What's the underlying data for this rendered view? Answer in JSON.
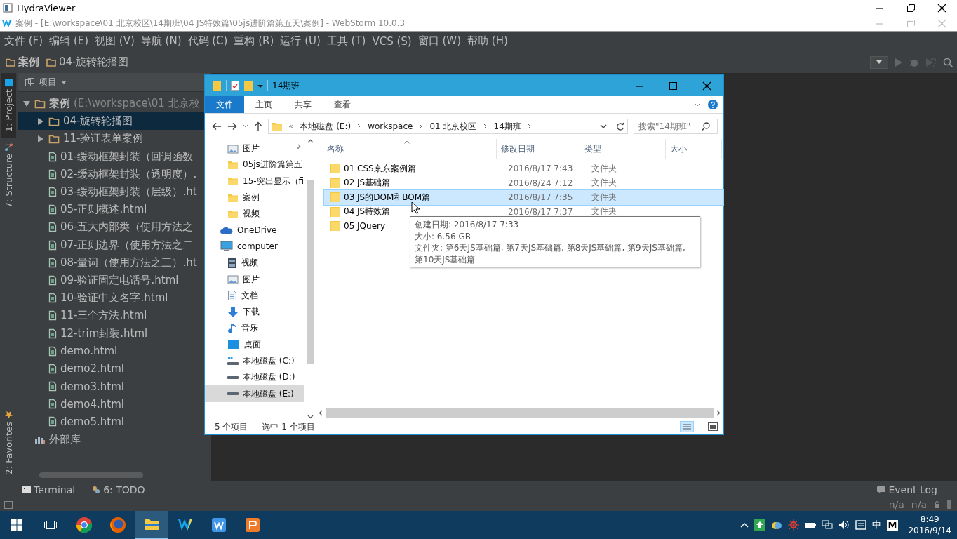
{
  "viewer": {
    "title": "HydraViewer"
  },
  "ide": {
    "title": "案例 - [E:\\workspace\\01 北京校区\\14期班\\04 JS特效篇\\05js进阶篇第五天\\案例] - WebStorm 10.0.3",
    "menu": [
      "文件 (F)",
      "编辑 (E)",
      "视图 (V)",
      "导航 (N)",
      "代码 (C)",
      "重构 (R)",
      "运行 (U)",
      "工具 (T)",
      "VCS (S)",
      "窗口 (W)",
      "帮助 (H)"
    ],
    "breadcrumbs": [
      "案例",
      "04-旋转轮播图"
    ],
    "side_tabs": [
      {
        "label": "1: Project",
        "selected": true
      },
      {
        "label": "7: Structure",
        "selected": false
      }
    ],
    "favorites_tab": "2: Favorites",
    "project_panel": {
      "title": "项目",
      "tree": [
        {
          "label": "案例",
          "detail": "(E:\\workspace\\01 北京校",
          "kind": "folder",
          "expanded": true,
          "selected": false,
          "children": [
            {
              "label": "04-旋转轮播图",
              "kind": "folder",
              "expanded": false,
              "selected": true
            },
            {
              "label": "11-验证表单案例",
              "kind": "folder",
              "expanded": false,
              "selected": false
            },
            {
              "label": "01-缓动框架封装（回调函数",
              "kind": "file",
              "selected": false
            },
            {
              "label": "02-缓动框架封装（透明度）.",
              "kind": "file",
              "selected": false
            },
            {
              "label": "03-缓动框架封装（层级）.ht",
              "kind": "file",
              "selected": false
            },
            {
              "label": "05-正则概述.html",
              "kind": "file",
              "selected": false
            },
            {
              "label": "06-五大内部类（使用方法之",
              "kind": "file",
              "selected": false
            },
            {
              "label": "07-正则边界（使用方法之二",
              "kind": "file",
              "selected": false
            },
            {
              "label": "08-量词（使用方法之三）.ht",
              "kind": "file",
              "selected": false
            },
            {
              "label": "09-验证固定电话号.html",
              "kind": "file",
              "selected": false
            },
            {
              "label": "10-验证中文名字.html",
              "kind": "file",
              "selected": false
            },
            {
              "label": "11-三个方法.html",
              "kind": "file",
              "selected": false
            },
            {
              "label": "12-trim封装.html",
              "kind": "file",
              "selected": false
            },
            {
              "label": "demo.html",
              "kind": "file",
              "selected": false
            },
            {
              "label": "demo2.html",
              "kind": "file",
              "selected": false
            },
            {
              "label": "demo3.html",
              "kind": "file",
              "selected": false
            },
            {
              "label": "demo4.html",
              "kind": "file",
              "selected": false
            },
            {
              "label": "demo5.html",
              "kind": "file",
              "selected": false
            }
          ]
        },
        {
          "label": "外部库",
          "kind": "library",
          "selected": false
        }
      ]
    },
    "bottom_tabs": [
      "Terminal",
      "6: TODO"
    ],
    "event_log": "Event Log",
    "status": [
      "n/a",
      "n/a"
    ]
  },
  "explorer": {
    "title": "14期班",
    "ribbon_tabs": [
      {
        "label": "文件",
        "selected": true
      },
      {
        "label": "主页",
        "selected": false
      },
      {
        "label": "共享",
        "selected": false
      },
      {
        "label": "查看",
        "selected": false
      }
    ],
    "overflow_mark": "«",
    "path": [
      "本地磁盘 (E:)",
      "workspace",
      "01 北京校区",
      "14期班"
    ],
    "search": {
      "placeholder": "搜索\"14期班\""
    },
    "nav": [
      {
        "label": "图片",
        "kind": "pictures",
        "pinned": true,
        "selected": false
      },
      {
        "label": "05js进阶篇第五",
        "kind": "folder",
        "pinned": false,
        "selected": false
      },
      {
        "label": "15-突出显示（fi",
        "kind": "folder",
        "pinned": false,
        "selected": false
      },
      {
        "label": "案例",
        "kind": "folder",
        "pinned": false,
        "selected": false
      },
      {
        "label": "视频",
        "kind": "folder",
        "pinned": false,
        "selected": false
      },
      {
        "label": "OneDrive",
        "kind": "onedrive",
        "pinned": false,
        "selected": false
      },
      {
        "label": "computer",
        "kind": "computer",
        "pinned": false,
        "selected": false,
        "children": [
          {
            "label": "视频",
            "kind": "video",
            "pinned": false,
            "selected": false
          },
          {
            "label": "图片",
            "kind": "pictures",
            "pinned": false,
            "selected": false
          },
          {
            "label": "文档",
            "kind": "documents",
            "pinned": false,
            "selected": false
          },
          {
            "label": "下载",
            "kind": "downloads",
            "pinned": false,
            "selected": false
          },
          {
            "label": "音乐",
            "kind": "music",
            "pinned": false,
            "selected": false
          },
          {
            "label": "桌面",
            "kind": "desktop",
            "pinned": false,
            "selected": false
          },
          {
            "label": "本地磁盘 (C:)",
            "kind": "system_drive",
            "pinned": false,
            "selected": false
          },
          {
            "label": "本地磁盘 (D:)",
            "kind": "drive",
            "pinned": false,
            "selected": false
          },
          {
            "label": "本地磁盘 (E:)",
            "kind": "drive",
            "pinned": false,
            "selected": true
          }
        ]
      }
    ],
    "columns": [
      "名称",
      "修改日期",
      "类型",
      "大小"
    ],
    "rows": [
      {
        "name": "01 CSS京东案例篇",
        "modified": "2016/8/17 7:43",
        "type": "文件夹",
        "selected": false
      },
      {
        "name": "02 JS基础篇",
        "modified": "2016/8/24 7:12",
        "type": "文件夹",
        "selected": false
      },
      {
        "name": "03 JS的DOM和BOM篇",
        "modified": "2016/8/17 7:35",
        "type": "文件夹",
        "selected": true
      },
      {
        "name": "04 JS特效篇",
        "modified": "2016/8/17 7:37",
        "type": "文件夹",
        "selected": false
      },
      {
        "name": "05 JQuery",
        "selected": false
      }
    ],
    "tooltip": [
      "创建日期: 2016/8/17 7:33",
      "大小: 6.56 GB",
      "文件夹: 第6天JS基础篇, 第7天JS基础篇, 第8天JS基础篇, 第9天JS基础篇, 第10天JS基础篇"
    ],
    "item_count": "5 个项目",
    "selection_count": "选中 1 个项目"
  },
  "taskbar": {
    "apps": [
      {
        "kind": "taskview",
        "selected": false
      },
      {
        "kind": "wheel",
        "selected": false
      },
      {
        "kind": "globe",
        "selected": false
      },
      {
        "kind": "files",
        "selected": true
      },
      {
        "kind": "ide",
        "selected": false
      },
      {
        "kind": "writer",
        "selected": false
      },
      {
        "kind": "slides",
        "selected": false
      }
    ],
    "ime": "中",
    "ime_mode": "M",
    "time": "8:49",
    "date": "2016/9/14"
  }
}
